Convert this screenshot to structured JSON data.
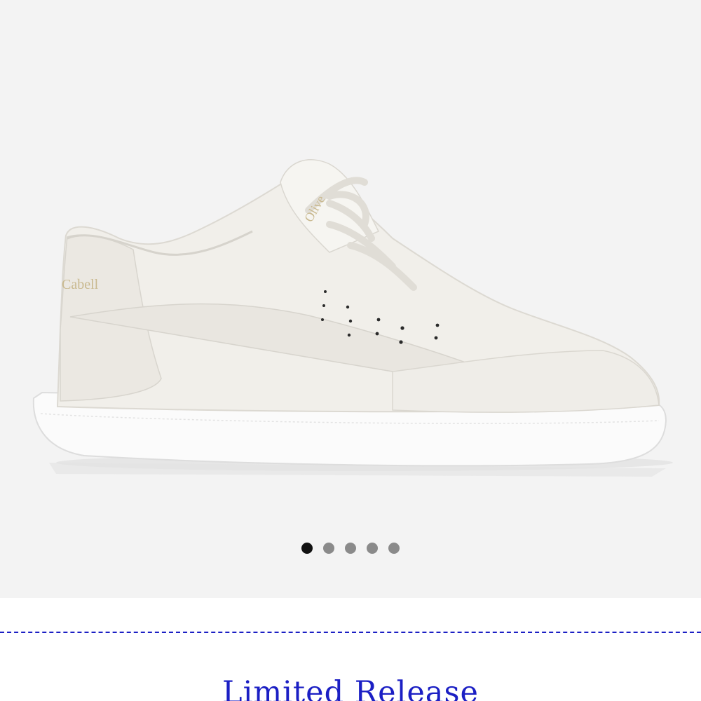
{
  "product": {
    "heel_brand_text": "Cabell",
    "tongue_brand_text": "Olive"
  },
  "carousel": {
    "total_slides": 5,
    "active_slide": 1
  },
  "section": {
    "title": "Limited Release"
  },
  "colors": {
    "hero_background": "#f3f3f3",
    "accent_blue": "#1b1fc4",
    "dot_active": "#111111",
    "dot_inactive": "#8a8a8a"
  },
  "icons": {
    "product": "sneaker-image"
  }
}
